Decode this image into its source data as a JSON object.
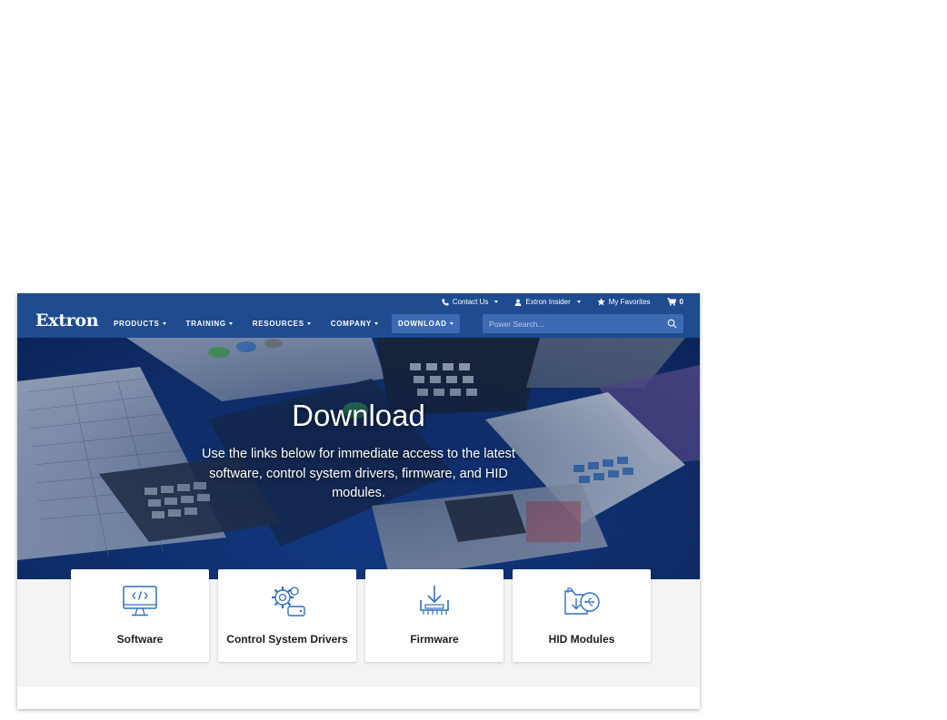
{
  "header": {
    "logo": "Extron",
    "utility": [
      {
        "label": "Contact Us",
        "icon": "phone-icon"
      },
      {
        "label": "Extron Insider",
        "icon": "user-icon"
      },
      {
        "label": "My Favorites",
        "icon": "star-icon"
      },
      {
        "label": "0",
        "icon": "cart-icon"
      }
    ],
    "nav": [
      {
        "label": "PRODUCTS"
      },
      {
        "label": "TRAINING"
      },
      {
        "label": "RESOURCES"
      },
      {
        "label": "COMPANY"
      },
      {
        "label": "DOWNLOAD",
        "active": true
      }
    ],
    "search": {
      "placeholder": "Power Search..."
    }
  },
  "hero": {
    "title": "Download",
    "subtitle": "Use the links below for immediate access to the latest software, control system drivers, firmware, and HID modules."
  },
  "cards": [
    {
      "label": "Software",
      "icon": "monitor-code-icon"
    },
    {
      "label": "Control System Drivers",
      "icon": "gears-drive-icon"
    },
    {
      "label": "Firmware",
      "icon": "download-chip-icon"
    },
    {
      "label": "HID Modules",
      "icon": "folder-usb-icon"
    }
  ],
  "colors": {
    "header_bg": "#1f4b8f",
    "accent": "#3c6bb4",
    "icon_blue": "#2f6fc0",
    "lower_bg": "#f4f4f4"
  }
}
